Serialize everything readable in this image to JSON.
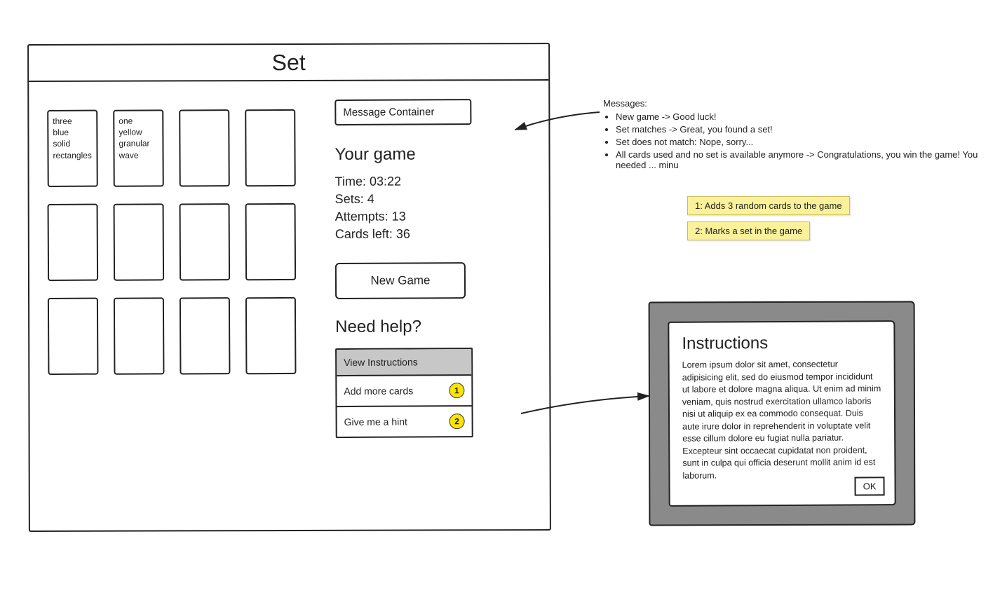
{
  "title": "Set",
  "cards": [
    {
      "lines": [
        "three",
        "blue",
        "solid",
        "rectangles"
      ]
    },
    {
      "lines": [
        "one",
        "yellow",
        "granular",
        "wave"
      ]
    },
    {
      "lines": []
    },
    {
      "lines": []
    },
    {
      "lines": []
    },
    {
      "lines": []
    },
    {
      "lines": []
    },
    {
      "lines": []
    },
    {
      "lines": []
    },
    {
      "lines": []
    },
    {
      "lines": []
    },
    {
      "lines": []
    }
  ],
  "message_container_label": "Message Container",
  "your_game_heading": "Your game",
  "stats": {
    "time_label": "Time:",
    "time_value": "03:22",
    "sets_label": "Sets:",
    "sets_value": "4",
    "attempts_label": "Attempts:",
    "attempts_value": "13",
    "cardsleft_label": "Cards left:",
    "cardsleft_value": "36"
  },
  "new_game_label": "New Game",
  "help_heading": "Need help?",
  "help_rows": {
    "view_instructions": "View Instructions",
    "add_more": "Add more cards",
    "hint": "Give me a hint"
  },
  "markers": {
    "one": "1",
    "two": "2"
  },
  "annotations": {
    "messages_title": "Messages:",
    "bullets": [
      "New game -> Good luck!",
      "Set matches -> Great, you found a set!",
      "Set does not match: Nope, sorry...",
      "All cards used and no set is available anymore -> Congratulations, you win the game! You needed ... minu"
    ],
    "sticky1": "1: Adds 3 random cards to the game",
    "sticky2": "2: Marks a set in the game"
  },
  "dialog": {
    "title": "Instructions",
    "body": "Lorem ipsum dolor sit amet, consectetur adipisicing elit, sed do eiusmod tempor incididunt ut labore et dolore magna aliqua. Ut enim ad minim veniam, quis nostrud exercitation ullamco laboris nisi ut aliquip ex ea commodo consequat. Duis aute irure dolor in reprehenderit in voluptate velit esse cillum dolore eu fugiat nulla pariatur. Excepteur sint occaecat cupidatat non proident, sunt in culpa qui officia deserunt mollit anim id est laborum.",
    "ok": "OK"
  }
}
